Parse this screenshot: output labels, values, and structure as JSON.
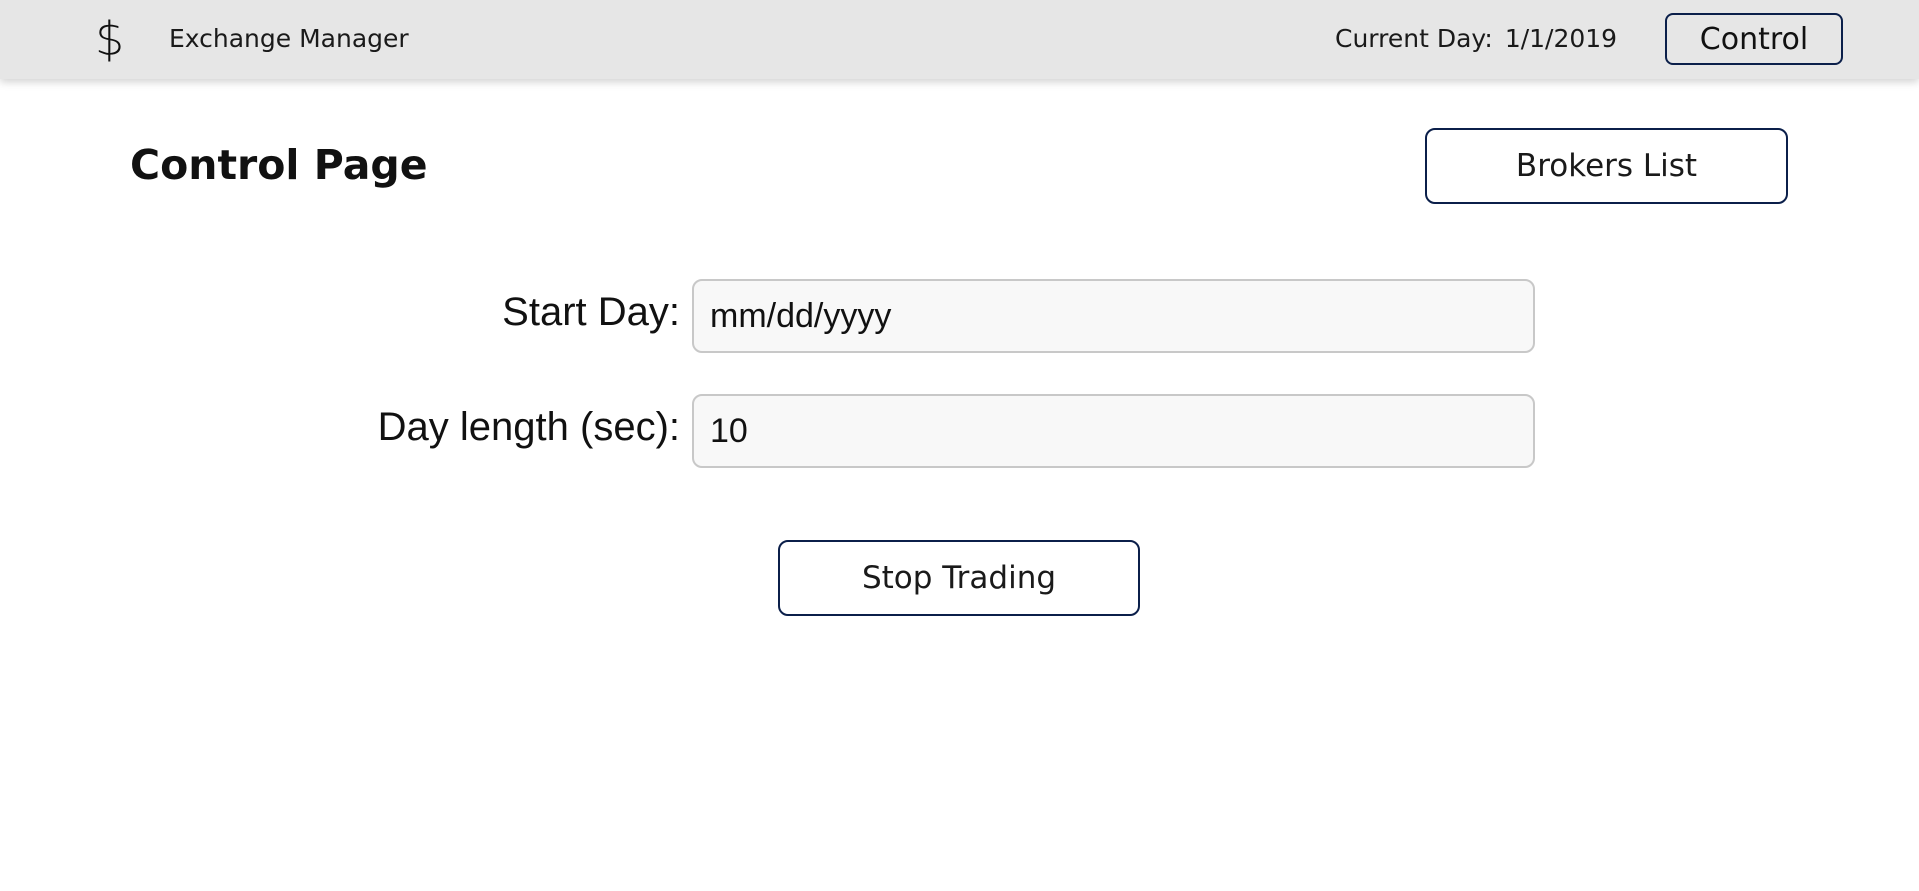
{
  "header": {
    "brand_icon": "$",
    "brand_title": "Exchange Manager",
    "current_day_label": "Current Day:",
    "current_day_value": "1/1/2019",
    "nav_button_label": "Control"
  },
  "main": {
    "page_title": "Control Page",
    "brokers_button_label": "Brokers List",
    "form": {
      "start_day": {
        "label": "Start Day:",
        "placeholder": "mm/dd/yyyy",
        "value": ""
      },
      "day_length": {
        "label": "Day length (sec):",
        "placeholder": "",
        "value": "10"
      }
    },
    "stop_button_label": "Stop Trading"
  },
  "colors": {
    "header_background": "#e6e6e6",
    "button_border": "#0b1f4a",
    "input_background": "#f8f8f8",
    "input_border": "#c8c8c8"
  }
}
